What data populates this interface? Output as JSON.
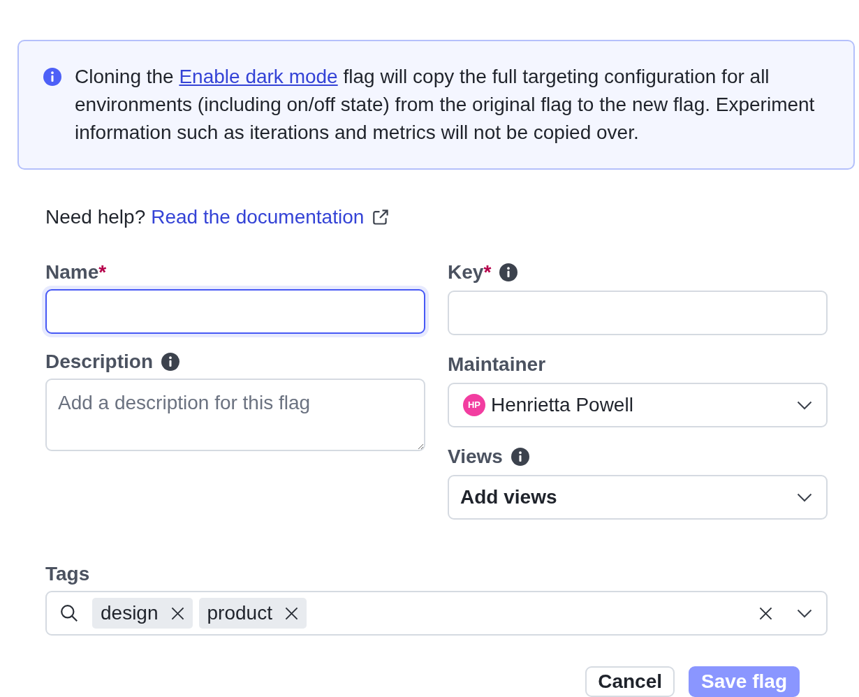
{
  "message": {
    "before": "Cloning the",
    "link": "Enable dark mode",
    "after": "flag will copy the full targeting configuration for all environments (including on/off state) from the original flag to the new flag. Experiment information such as iterations and metrics will not be copied over."
  },
  "help": {
    "prompt": "Need help?",
    "link": "Read the documentation"
  },
  "left_column": [
    {
      "label": "Name",
      "required_mark": "*",
      "info": false,
      "kind": "text",
      "focused": true
    },
    {
      "label": "Description",
      "info": true,
      "kind": "textarea",
      "placeholder": "Add a description for this flag",
      "focused": false
    }
  ],
  "right_column": [
    {
      "label": "Key",
      "required_mark": "*",
      "info": true,
      "kind": "text",
      "focused": false
    },
    {
      "label": "Maintainer",
      "info": false,
      "kind": "select",
      "avatar": "HP",
      "value": "Henrietta Powell",
      "focused": false
    },
    {
      "label": "Views",
      "info": true,
      "kind": "select",
      "placeholder": "Add views",
      "focused": false
    }
  ],
  "tags": {
    "label": "Tags",
    "chips": [
      "design",
      "product"
    ]
  },
  "buttons": [
    {
      "label": "Cancel",
      "kind": "secondary",
      "disabled": false
    },
    {
      "label": "Save flag",
      "kind": "primary",
      "disabled": true
    }
  ]
}
